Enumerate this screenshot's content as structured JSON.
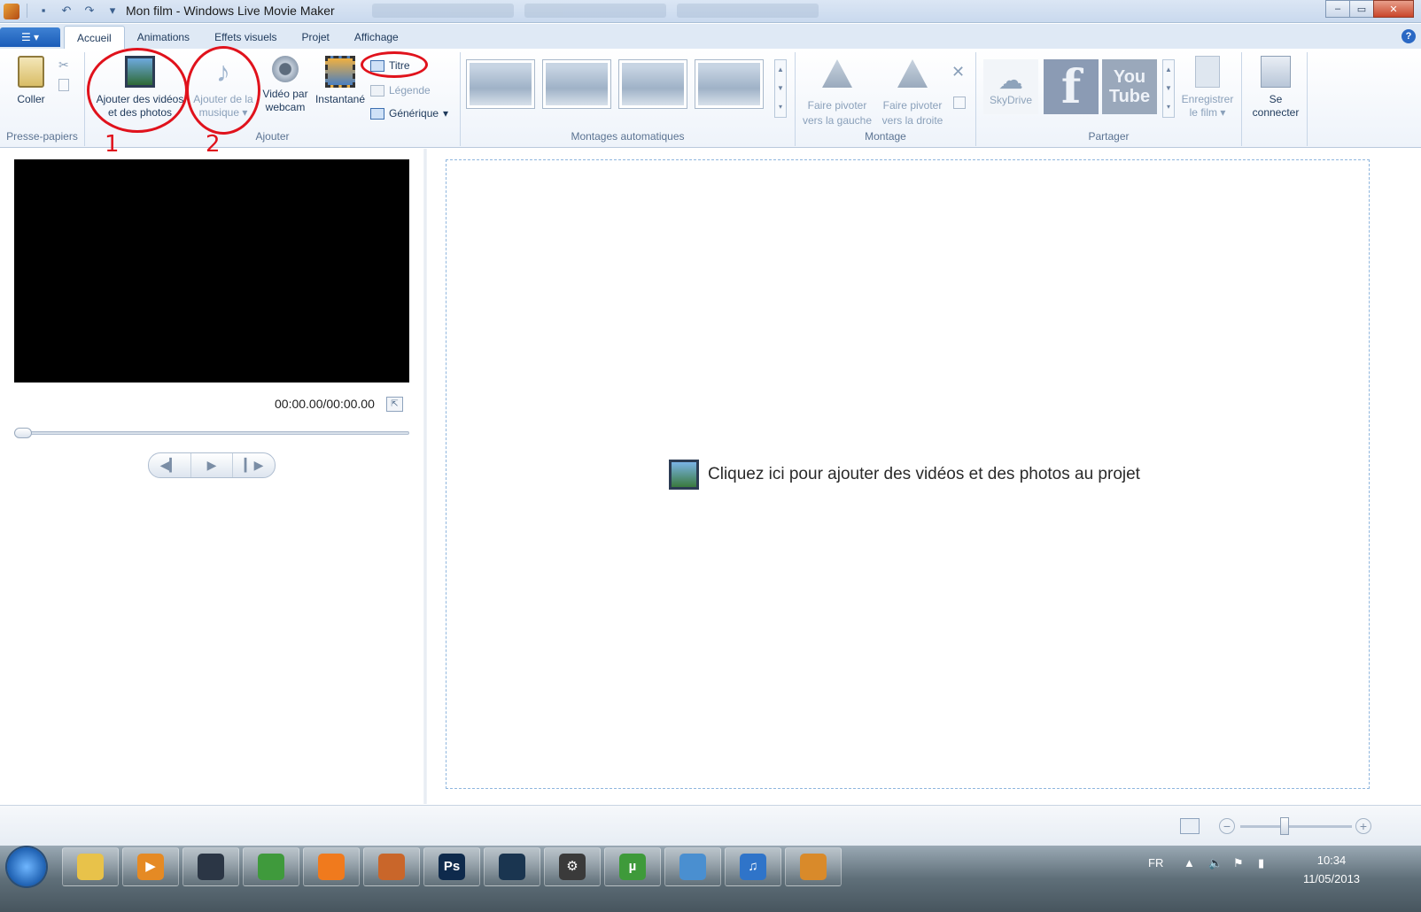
{
  "window": {
    "title": "Mon film - Windows Live Movie Maker",
    "controls": [
      "–",
      "▭",
      "✕"
    ]
  },
  "tabs": [
    "Accueil",
    "Animations",
    "Effets visuels",
    "Projet",
    "Affichage"
  ],
  "help": "?",
  "ribbon": {
    "clipboard": {
      "paste": "Coller",
      "group": "Presse-papiers"
    },
    "add": {
      "add_videos_photos_line1": "Ajouter des vidéos",
      "add_videos_photos_line2": "et des photos",
      "add_music_line1": "Ajouter de la",
      "add_music_line2": "musique",
      "webcam_line1": "Vidéo par",
      "webcam_line2": "webcam",
      "snapshot": "Instantané",
      "title": "Titre",
      "caption": "Légende",
      "credits": "Générique",
      "group": "Ajouter"
    },
    "automovie": {
      "group": "Montages automatiques"
    },
    "editing": {
      "rotate_left_line1": "Faire pivoter",
      "rotate_left_line2": "vers la gauche",
      "rotate_right_line1": "Faire pivoter",
      "rotate_right_line2": "vers la droite",
      "group": "Montage"
    },
    "share": {
      "skydrive": "SkyDrive",
      "facebook": "f",
      "youtube_line1": "You",
      "youtube_line2": "Tube",
      "save_line1": "Enregistrer",
      "save_line2": "le film",
      "group": "Partager"
    },
    "signin": {
      "line1": "Se",
      "line2": "connecter"
    }
  },
  "annotations": {
    "one": "1",
    "two": "2"
  },
  "preview": {
    "timecode": "00:00.00/00:00.00"
  },
  "playback": {
    "prev": "◀▎",
    "play": "▶",
    "next": "▎▶"
  },
  "storyboard": {
    "prompt": "Cliquez ici pour ajouter des vidéos et des photos au projet"
  },
  "zoom": {
    "minus": "−",
    "plus": "+"
  },
  "taskbar": {
    "apps": [
      {
        "name": "explorer",
        "color": "#e8c24a",
        "glyph": ""
      },
      {
        "name": "media-player",
        "color": "#e58a24",
        "glyph": "▶"
      },
      {
        "name": "steam",
        "color": "#2b3645",
        "glyph": ""
      },
      {
        "name": "chrome",
        "color": "#3f9a3c",
        "glyph": ""
      },
      {
        "name": "origin",
        "color": "#f07a1d",
        "glyph": ""
      },
      {
        "name": "cyberlink",
        "color": "#c9662a",
        "glyph": ""
      },
      {
        "name": "photoshop",
        "color": "#0e2a4c",
        "glyph": "Ps"
      },
      {
        "name": "dvd-app",
        "color": "#1a3550",
        "glyph": ""
      },
      {
        "name": "settings-app",
        "color": "#3a3a3a",
        "glyph": "⚙"
      },
      {
        "name": "utorrent",
        "color": "#3e9a3a",
        "glyph": "µ"
      },
      {
        "name": "messenger",
        "color": "#4a8fd0",
        "glyph": ""
      },
      {
        "name": "itunes",
        "color": "#2f74c9",
        "glyph": "♫"
      },
      {
        "name": "movie-maker",
        "color": "#d98a2a",
        "glyph": ""
      }
    ],
    "lang": "FR",
    "time": "10:34",
    "date": "11/05/2013"
  }
}
